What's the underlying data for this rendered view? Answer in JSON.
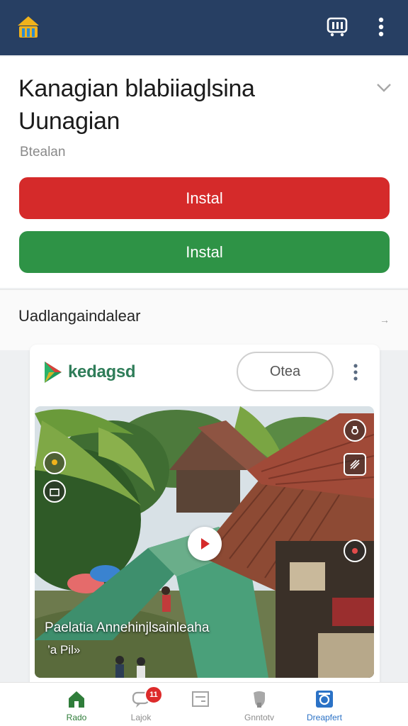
{
  "header": {
    "logo_icon": "house-bars-icon",
    "actions": [
      {
        "icon": "cast-icon"
      },
      {
        "icon": "more-vertical-icon"
      }
    ]
  },
  "app": {
    "title": "Kanagian blabiiaglsina Uunagian",
    "subtitle": "Btealan",
    "expand_icon": "chevron-down-icon",
    "primary_button": {
      "label": "Instal",
      "color": "#d52a2a"
    },
    "secondary_button": {
      "label": "Instal",
      "color": "#2e9346"
    }
  },
  "section": {
    "label": "Uadlangaindalear",
    "arrow": "→"
  },
  "card": {
    "brand_name": "kedagsd",
    "brand_color": "#2f7d59",
    "action_label": "Otea",
    "media": {
      "caption": "Paelatia Annehinjlsainleaha",
      "subcaption": "’a Pil»",
      "play_icon": "play-icon"
    }
  },
  "bottom_nav": [
    {
      "label": "Rado",
      "icon": "home-icon",
      "active": true
    },
    {
      "label": "Lajok",
      "icon": "chat-icon",
      "badge": "11"
    },
    {
      "label": "",
      "icon": "document-icon"
    },
    {
      "label": "Gnntotv",
      "icon": "shield-icon"
    },
    {
      "label": "Dreapfert",
      "icon": "browser-icon",
      "active": true
    }
  ],
  "colors": {
    "header_bg": "#273f63",
    "accent_blue": "#2b72c6",
    "accent_green": "#2f7d3a"
  }
}
